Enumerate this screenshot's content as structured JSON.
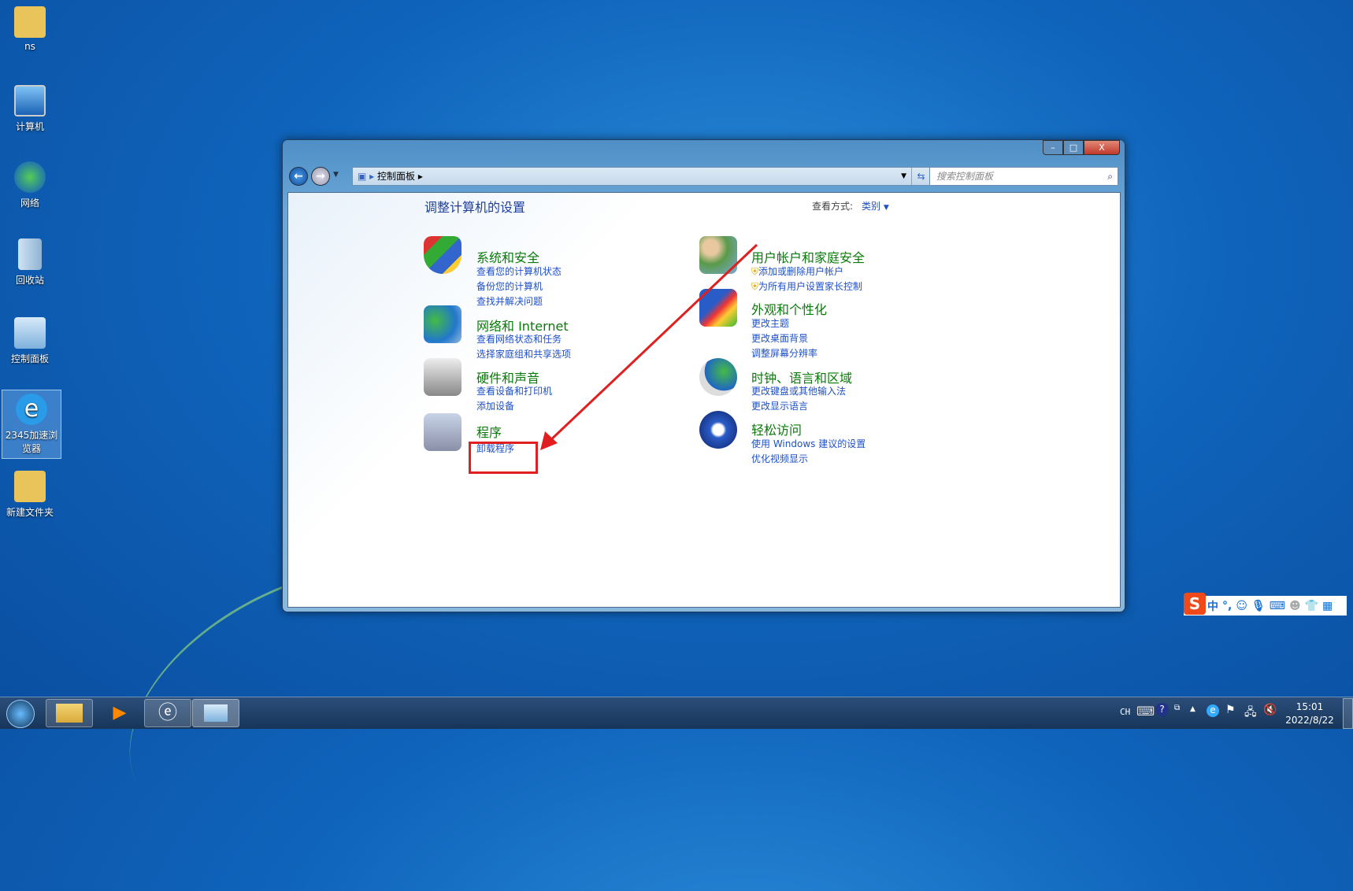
{
  "desktop": {
    "icons": [
      {
        "label": "ns"
      },
      {
        "label": "计算机"
      },
      {
        "label": "网络"
      },
      {
        "label": "回收站"
      },
      {
        "label": "控制面板"
      },
      {
        "label": "2345加速浏览器"
      },
      {
        "label": "新建文件夹"
      }
    ]
  },
  "window": {
    "address": {
      "path": "控制面板"
    },
    "search": {
      "placeholder": "搜索控制面板"
    },
    "heading": "调整计算机的设置",
    "view_by_label": "查看方式:",
    "view_by_value": "类别",
    "categories": [
      {
        "title": "系统和安全",
        "links": [
          "查看您的计算机状态",
          "备份您的计算机",
          "查找并解决问题"
        ]
      },
      {
        "title": "网络和 Internet",
        "links": [
          "查看网络状态和任务",
          "选择家庭组和共享选项"
        ]
      },
      {
        "title": "硬件和声音",
        "links": [
          "查看设备和打印机",
          "添加设备"
        ]
      },
      {
        "title": "程序",
        "links": [
          "卸载程序"
        ]
      },
      {
        "title": "用户帐户和家庭安全",
        "links": [
          "添加或删除用户帐户",
          "为所有用户设置家长控制"
        ]
      },
      {
        "title": "外观和个性化",
        "links": [
          "更改主题",
          "更改桌面背景",
          "调整屏幕分辨率"
        ]
      },
      {
        "title": "时钟、语言和区域",
        "links": [
          "更改键盘或其他输入法",
          "更改显示语言"
        ]
      },
      {
        "title": "轻松访问",
        "links": [
          "使用 Windows 建议的设置",
          "优化视频显示"
        ]
      }
    ]
  },
  "ime": {
    "mode": "中",
    "punct": "°,"
  },
  "taskbar": {
    "lang": "CH",
    "time": "15:01",
    "date": "2022/8/22"
  },
  "colors": {
    "annotation": "#e02020",
    "heading": "#0a7a0a",
    "link": "#1e50c8"
  }
}
